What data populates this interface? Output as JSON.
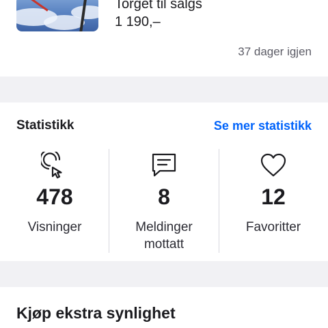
{
  "listing": {
    "title": "Torget til salgs",
    "price": "1 190,–",
    "days_left": "37 dager igjen"
  },
  "statistics": {
    "title": "Statistikk",
    "more_link": "Se mer statistikk",
    "items": [
      {
        "icon": "cursor-click-icon",
        "value": "478",
        "label": "Visninger"
      },
      {
        "icon": "message-icon",
        "value": "8",
        "label_line1": "Meldinger",
        "label_line2": "mottatt"
      },
      {
        "icon": "heart-icon",
        "value": "12",
        "label": "Favoritter"
      }
    ]
  },
  "visibility": {
    "title": "Kjøp ekstra synlighet"
  },
  "colors": {
    "accent": "#0063fb",
    "background": "#f1f1f4",
    "card": "#ffffff",
    "text": "#1b1b1f",
    "muted": "#5c5c66"
  }
}
